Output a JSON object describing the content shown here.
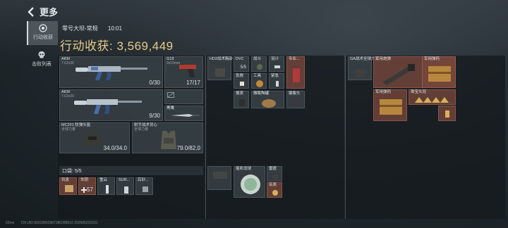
{
  "header": {
    "title": "更多"
  },
  "side_tabs": [
    {
      "label": "行动收获",
      "icon": "target-icon",
      "active": true
    },
    {
      "label": "击败列表",
      "icon": "skull-icon",
      "active": false
    }
  ],
  "raid": {
    "map": "零号大坝-常规",
    "time": "10:01",
    "income_label": "行动收获:",
    "income_value": "3,569,449"
  },
  "weapons": [
    {
      "name": "AKM",
      "sub": "7.62x39",
      "count": "0/30"
    },
    {
      "name": "G18",
      "sub": "9x19mm",
      "count": "17/17"
    },
    {
      "name": "AKM",
      "sub": "7.62x39",
      "count": "9/30"
    },
    {
      "name": "黑鹰",
      "sub": "",
      "count": ""
    }
  ],
  "armor": [
    {
      "name": "MC201 防弹头盔",
      "sub": "全球力量",
      "count": "34.0/34.0"
    },
    {
      "name": "射手战术背心",
      "sub": "全球力量",
      "count": "79.0/82.0"
    }
  ],
  "pocket": {
    "label": "口袋: 5/5",
    "items": [
      {
        "label": "讯息",
        "count": ""
      },
      {
        "label": "车钥",
        "count": "57"
      },
      {
        "label": "重云",
        "count": ""
      },
      {
        "label": "SUR...",
        "count": ""
      },
      {
        "label": "后砂...",
        "count": ""
      }
    ]
  },
  "rig": {
    "items": [
      {
        "label": "HD2战术胸卦",
        "count": ""
      },
      {
        "label": "DVC",
        "count": "5/5"
      },
      {
        "label": "战斗",
        "count": ""
      },
      {
        "label": "设计",
        "count": ""
      },
      {
        "label": "专业...",
        "count": ""
      },
      {
        "label": "急救",
        "count": ""
      },
      {
        "label": "工具",
        "count": ""
      },
      {
        "label": "紧急",
        "count": ""
      },
      {
        "label": "报表",
        "count": ""
      },
      {
        "label": "雅致陶罐",
        "count": ""
      },
      {
        "label": "摄像头",
        "count": ""
      }
    ]
  },
  "backpack": {
    "items": [
      {
        "label": "摇彩龙球",
        "count": ""
      },
      {
        "label": "雷霆",
        "count": ""
      },
      {
        "label": "名表",
        "count": ""
      }
    ]
  },
  "safebox": {
    "items": [
      {
        "label": "GA战术全球力量",
        "count": ""
      },
      {
        "label": "军用炮弹",
        "count": ""
      },
      {
        "label": "军用弹药",
        "count": ""
      },
      {
        "label": "军用弹药",
        "count": ""
      },
      {
        "label": "珠宝头冠",
        "count": ""
      }
    ]
  },
  "footer": {
    "ping": "52ms",
    "uid": "CN UID:90229892987380288510 202605231031"
  }
}
